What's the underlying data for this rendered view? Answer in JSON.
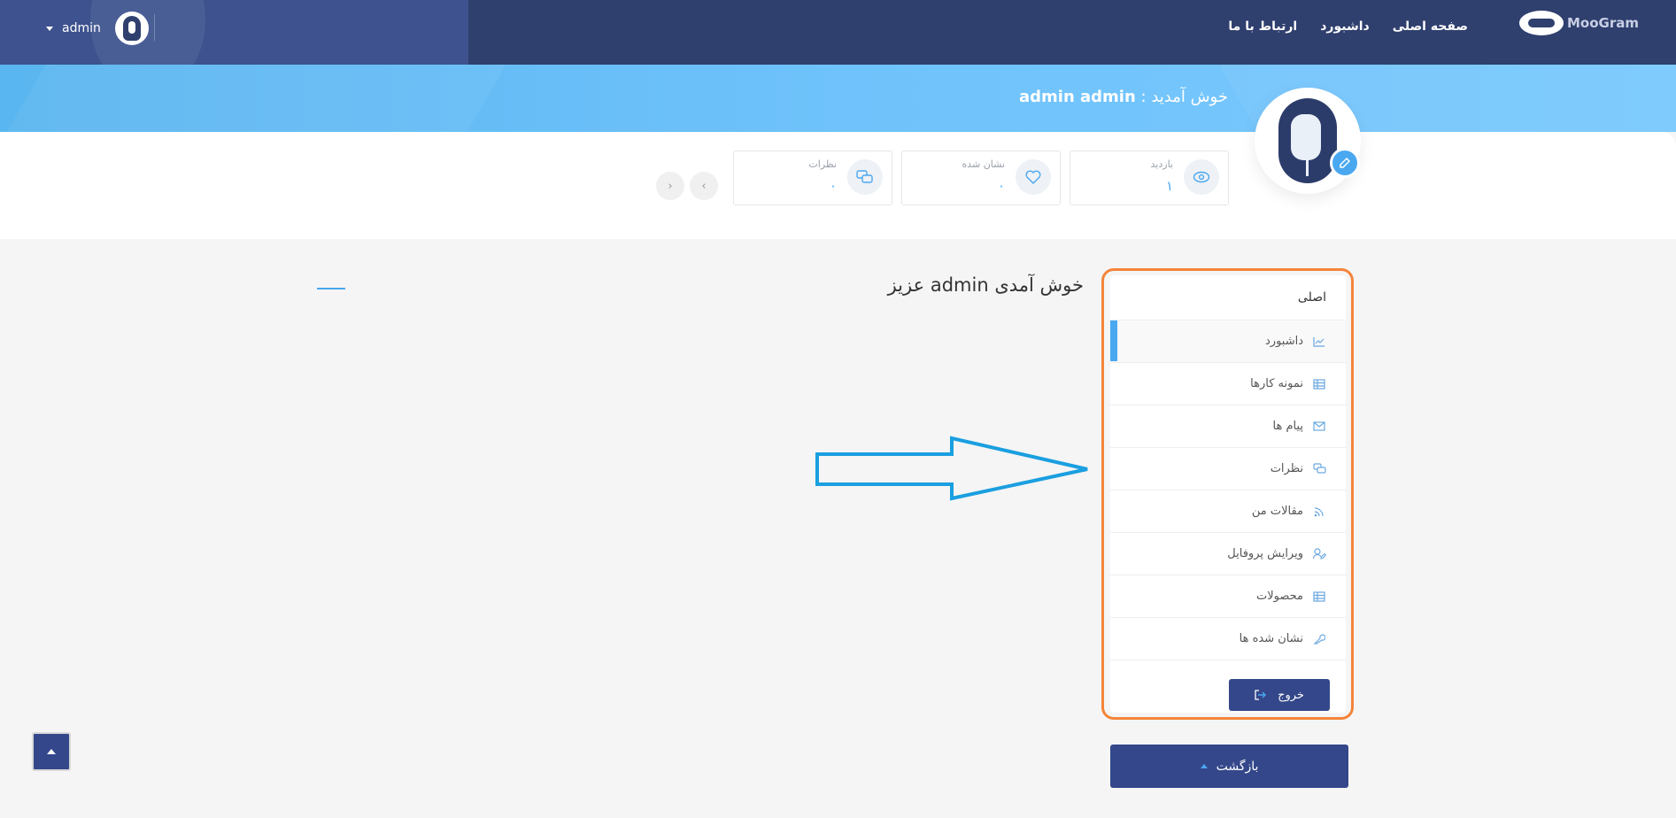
{
  "header": {
    "user_name": "admin",
    "nav": [
      "صفحه اصلی",
      "داشبورد",
      "ارتباط با ما"
    ],
    "logo_text": "MooGram"
  },
  "banner": {
    "welcome_prefix": "خوش آمدید :",
    "full_name": "admin admin"
  },
  "stats": [
    {
      "label": "بازدید",
      "value": "۱",
      "icon": "eye-icon"
    },
    {
      "label": "نشان شده",
      "value": "۰",
      "icon": "heart-icon"
    },
    {
      "label": "نظرات",
      "value": "۰",
      "icon": "comments-icon"
    }
  ],
  "pager": {
    "prev": "‹",
    "next": "›"
  },
  "main": {
    "title": "خوش آمدی admin عزیز"
  },
  "sidebar": {
    "title": "اصلی",
    "items": [
      {
        "label": "داشبورد",
        "icon": "chart-icon",
        "active": true
      },
      {
        "label": "نمونه کارها",
        "icon": "table-icon"
      },
      {
        "label": "پیام ها",
        "icon": "envelope-icon"
      },
      {
        "label": "نظرات",
        "icon": "comments-icon"
      },
      {
        "label": "مقالات من",
        "icon": "rss-icon"
      },
      {
        "label": "ویرایش پروفایل",
        "icon": "user-edit-icon"
      },
      {
        "label": "محصولات",
        "icon": "table-icon"
      },
      {
        "label": "نشان شده ها",
        "icon": "wrench-icon"
      }
    ],
    "logout_label": "خروج"
  },
  "back_label": "بازگشت",
  "colors": {
    "topbar": "#2f3f6e",
    "accent": "#4aa8f0",
    "button": "#34478a",
    "highlight_outline": "#f4843a",
    "annotation_arrow": "#1a9fe0"
  }
}
